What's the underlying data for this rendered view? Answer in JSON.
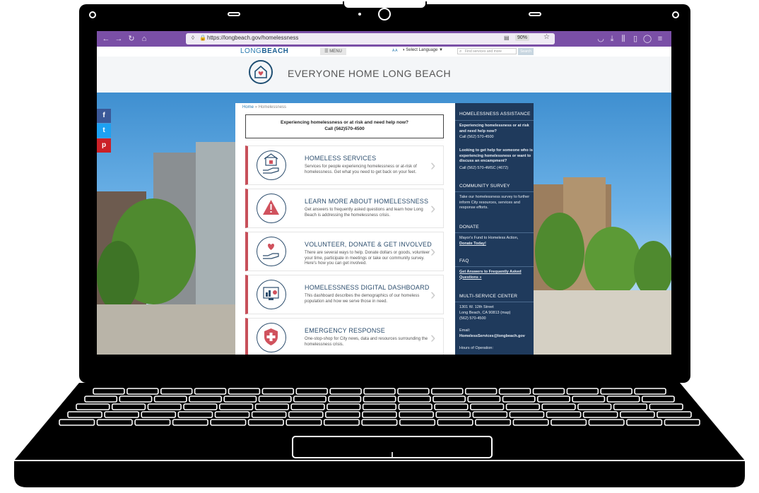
{
  "browser": {
    "url": "https://longbeach.gov/homelessness",
    "zoom": "90%"
  },
  "site_nav": {
    "logo_long": "LONG",
    "logo_beach": "BEACH",
    "menu_label": "MENU",
    "language_label": "Select Language",
    "search_placeholder": "Find services and more",
    "search_button": "Search"
  },
  "header": {
    "title": "EVERYONE HOME LONG BEACH"
  },
  "social": [
    "f",
    "t",
    "p"
  ],
  "breadcrumb": {
    "home": "Home",
    "current": "» Homelessness"
  },
  "alert": {
    "line1": "Experiencing homelessness or at risk and need help now?",
    "line2": "Call (562)570-4500"
  },
  "cards": [
    {
      "title": "HOMELESS SERVICES",
      "desc": "Services for people experiencing homelessness or at-risk of homelessness. Get what you need to get back on your feet.",
      "icon": "house-hand-icon"
    },
    {
      "title": "LEARN MORE ABOUT HOMELESSNESS",
      "desc": "Get answers to frequently asked questions and learn how Long Beach is addressing the homelessness crisis.",
      "icon": "warning-icon"
    },
    {
      "title": "VOLUNTEER, DONATE & GET INVOLVED",
      "desc": "There are several ways to help. Donate dollars or goods, volunteer your time, participate in meetings or take our community survey. Here's how you can get involved.",
      "icon": "heart-hand-icon"
    },
    {
      "title": "HOMELESSNESS DIGITAL DASHBOARD",
      "desc": "This dashboard describes the demographics of our homeless population and how we serve those in need.",
      "icon": "dashboard-icon"
    },
    {
      "title": "EMERGENCY RESPONSE",
      "desc": "One-stop-shop for City news, data and resources surrounding the homelessness crisis.",
      "icon": "shield-cross-icon"
    }
  ],
  "sidebar": {
    "assist_heading": "HOMELESSNESS ASSISTANCE",
    "assist_q1": "Experiencing homelessness or at risk and need help now?",
    "assist_call1": "Call (562) 570-4500",
    "assist_q2": "Looking to get help for someone who is experiencing homelessness or want to discuss an encampment?",
    "assist_call2": "Call (562) 570-4MSC (4672)",
    "survey_heading": "COMMUNITY SURVEY",
    "survey_text": "Take our homelessness survey to further inform City resources, services and response efforts.",
    "donate_heading": "DONATE",
    "donate_text": "Mayor's Fund to Homeless Action,",
    "donate_link": "Donate Today!",
    "faq_heading": "FAQ",
    "faq_link": "Get Answers to Frequently Asked Questions »",
    "msc_heading": "MULTI-SERVICE CENTER",
    "msc_addr1": "1301 W. 12th Street",
    "msc_addr2": "Long Beach, CA 90813 (map)",
    "msc_phone": "(562) 570-4500",
    "email_label": "Email:",
    "email": "HomelessServices@longbeach.gov",
    "hours_label": "Hours of Operation:"
  },
  "colors": {
    "chrome": "#7a4fa6",
    "sidebar": "#1f3a5c",
    "accent_red": "#c7505a",
    "facebook": "#3b5998",
    "twitter": "#1da1f2",
    "pinterest": "#cb2027"
  }
}
